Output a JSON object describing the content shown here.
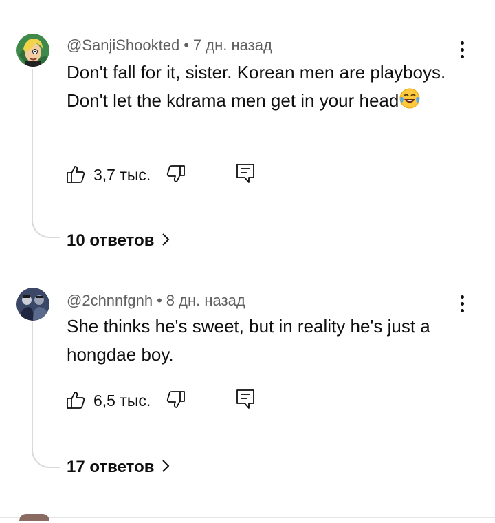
{
  "comments": [
    {
      "author": "@SanjiShookted",
      "separator": "•",
      "time": "7 дн. назад",
      "text": "Don't fall for it, sister. Korean men are playboys. Don't let the kdrama men get in your head",
      "emoji": "face-with-tears-of-joy",
      "likes": "3,7 тыс.",
      "replies": "10 ответов"
    },
    {
      "author": "@2chnnfgnh",
      "separator": "•",
      "time": "8 дн. назад",
      "text": "She thinks he's sweet, but in reality he's just a hongdae boy.",
      "likes": "6,5 тыс.",
      "replies": "17 ответов"
    }
  ],
  "icons": {
    "like": "thumbs-up-icon",
    "dislike": "thumbs-down-icon",
    "reply": "reply-comment-icon",
    "more": "more-vertical-icon",
    "expand": "chevron-right-icon"
  },
  "colors": {
    "text": "#0f0f0f",
    "meta": "#606060",
    "thread_line": "#d9d9d9"
  }
}
